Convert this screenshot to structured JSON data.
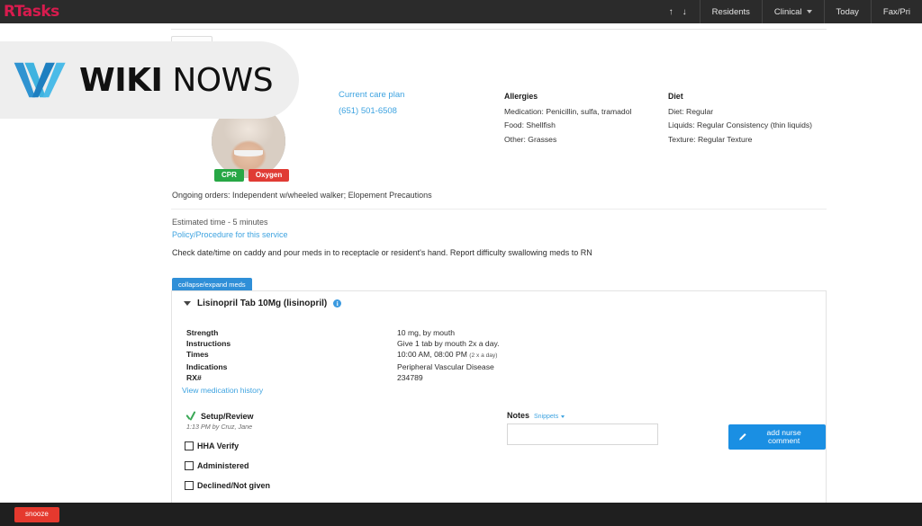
{
  "topbar": {
    "brand": "RTasks",
    "up_arrow": "↑",
    "down_arrow": "↓",
    "items": [
      {
        "label": "Residents",
        "has_caret": false
      },
      {
        "label": "Clinical",
        "has_caret": true
      },
      {
        "label": "Today",
        "has_caret": false
      },
      {
        "label": "Fax/Pri",
        "has_caret": false
      }
    ]
  },
  "resident": {
    "badges": [
      {
        "label": "CPR",
        "color": "#27a745"
      },
      {
        "label": "Oxygen",
        "color": "#e03b34"
      }
    ],
    "care_plan_link": "Current care plan",
    "phone": "(651) 501-6508"
  },
  "allergies": {
    "heading": "Allergies",
    "medication": "Medication: Penicillin, sulfa, tramadol",
    "food": "Food: Shellfish",
    "other": "Other: Grasses"
  },
  "diet": {
    "heading": "Diet",
    "diet": "Diet: Regular",
    "liquids": "Liquids: Regular Consistency (thin liquids)",
    "texture": "Texture: Regular Texture"
  },
  "orders": {
    "text": "Ongoing orders: Independent w/wheeled walker; Elopement Precautions"
  },
  "estimate": {
    "time": "Estimated time - 5 minutes",
    "policy_link": "Policy/Procedure for this service"
  },
  "instruction": {
    "text": "Check date/time on caddy and pour meds in to receptacle or resident's hand. Report difficulty swallowing meds to RN"
  },
  "collapse": {
    "label": "collapse/expand meds"
  },
  "medication": {
    "name": "Lisinopril Tab 10Mg (lisinopril)",
    "info_glyph": "i",
    "details": [
      {
        "label": "Strength",
        "value": "10 mg, by mouth",
        "note": ""
      },
      {
        "label": "Instructions",
        "value": "Give 1 tab by mouth 2x a day.",
        "note": ""
      },
      {
        "label": "Times",
        "value": "10:00 AM, 08:00 PM",
        "note": "(2 x a day)"
      },
      {
        "label": "Indications",
        "value": "Peripheral Vascular Disease",
        "note": ""
      },
      {
        "label": "RX#",
        "value": "234789",
        "note": ""
      }
    ],
    "history_link": "View medication history"
  },
  "actions": {
    "setup_label": "Setup/Review",
    "setup_byline": "1:13 PM by Cruz, Jane",
    "checkboxes": [
      {
        "label": "HHA Verify"
      },
      {
        "label": "Administered"
      },
      {
        "label": "Declined/Not given"
      }
    ]
  },
  "notes": {
    "heading": "Notes",
    "snippets_label": "Snippets",
    "value": "",
    "placeholder": ""
  },
  "nurse_comment": {
    "label": "add nurse comment",
    "color": "#1a8fe3"
  },
  "bottombar": {
    "snooze_label": "snooze",
    "snooze_color": "#e5392e"
  },
  "watermark": {
    "bold_text": "WIKI",
    "light_text": " NOWS"
  }
}
